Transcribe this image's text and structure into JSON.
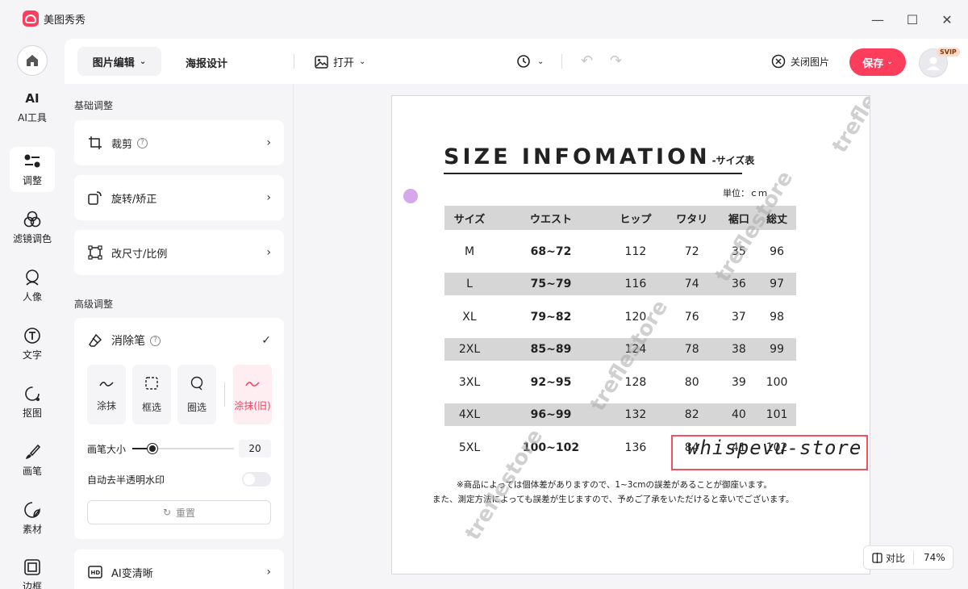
{
  "app": {
    "title": "美图秀秀"
  },
  "window": {
    "minimize": "—",
    "maximize": "☐",
    "close": "✕"
  },
  "rail": {
    "items": [
      {
        "label": "AI工具",
        "icon": "ai-icon"
      },
      {
        "label": "调整",
        "icon": "adjust-icon",
        "active": true
      },
      {
        "label": "滤镜调色",
        "icon": "filter-icon"
      },
      {
        "label": "人像",
        "icon": "portrait-icon"
      },
      {
        "label": "文字",
        "icon": "text-icon"
      },
      {
        "label": "抠图",
        "icon": "cutout-icon"
      },
      {
        "label": "画笔",
        "icon": "brush-icon"
      },
      {
        "label": "素材",
        "icon": "sticker-icon"
      },
      {
        "label": "边框",
        "icon": "frame-icon"
      }
    ]
  },
  "toolbar": {
    "tab_edit": "图片编辑",
    "tab_poster": "海报设计",
    "open": "打开",
    "close_image": "关闭图片",
    "save": "保存",
    "svip": "SVIP"
  },
  "panel": {
    "basic_title": "基础调整",
    "basic_items": [
      {
        "label": "裁剪",
        "help": "?"
      },
      {
        "label": "旋转/矫正"
      },
      {
        "label": "改尺寸/比例"
      }
    ],
    "advanced_title": "高级调整",
    "eraser": {
      "title": "消除笔",
      "help": "?",
      "tools": [
        "涂抹",
        "框选",
        "圈选",
        "涂抹(旧)"
      ],
      "active_tool": "涂抹(旧)",
      "brush_label": "画笔大小",
      "brush_value": "20",
      "brush_fraction": 0.2,
      "auto_watermark_label": "自动去半透明水印",
      "auto_watermark_on": false,
      "reset_label": "重置"
    },
    "ai_clear": "AI变清晰"
  },
  "document": {
    "title_main": "SIZE INFOMATION",
    "title_sub": "-サイズ表",
    "unit": "単位：ｃｍ",
    "headers": [
      "サイズ",
      "ウエスト",
      "ヒップ",
      "ワタリ",
      "裾口",
      "総丈"
    ],
    "rows": [
      [
        "M",
        "68~72",
        "112",
        "72",
        "35",
        "96"
      ],
      [
        "L",
        "75~79",
        "116",
        "74",
        "36",
        "97"
      ],
      [
        "XL",
        "79~82",
        "120",
        "76",
        "37",
        "98"
      ],
      [
        "2XL",
        "85~89",
        "124",
        "78",
        "38",
        "99"
      ],
      [
        "3XL",
        "92~95",
        "128",
        "80",
        "39",
        "100"
      ],
      [
        "4XL",
        "96~99",
        "132",
        "82",
        "40",
        "101"
      ],
      [
        "5XL",
        "100~102",
        "136",
        "84",
        "41",
        "102"
      ]
    ],
    "note1": "※商品によっては個体差がありますので、1~3cmの誤差があることが御座います。",
    "note2": "また、測定方法によっても誤差が生じますので、予めご了承をいただけると幸いでございます。",
    "watermark": "treflestore",
    "overlay_text": "whispevu-store"
  },
  "bottom": {
    "compare": "对比",
    "zoom": "74%"
  },
  "colors": {
    "accent": "#fd3d5c",
    "selection": "#f0525f",
    "brush": "#d5a8ec"
  }
}
